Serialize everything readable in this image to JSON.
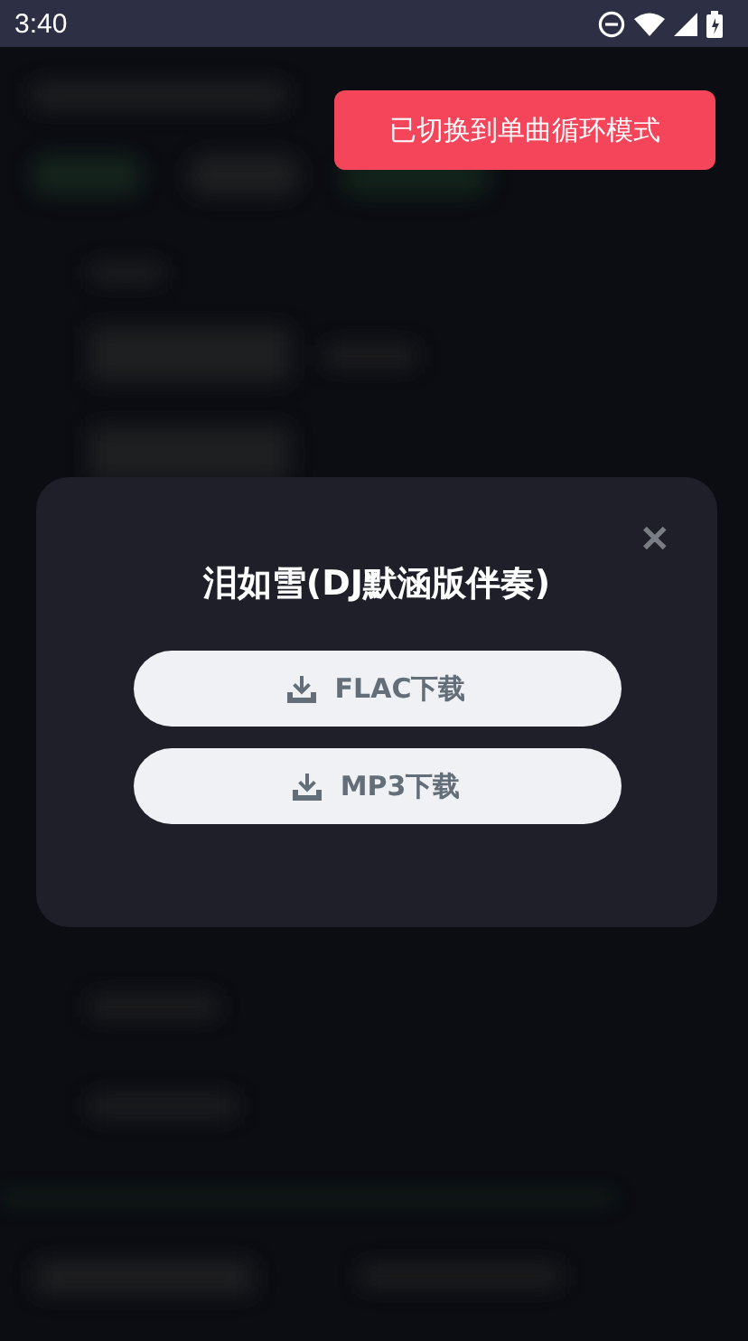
{
  "status_bar": {
    "time": "3:40"
  },
  "toast": {
    "text": "已切换到单曲循环模式"
  },
  "dialog": {
    "title": "泪如雪(DJ默涵版伴奏)",
    "close": "✕",
    "buttons": [
      {
        "label": "FLAC下载"
      },
      {
        "label": "MP3下载"
      }
    ]
  }
}
